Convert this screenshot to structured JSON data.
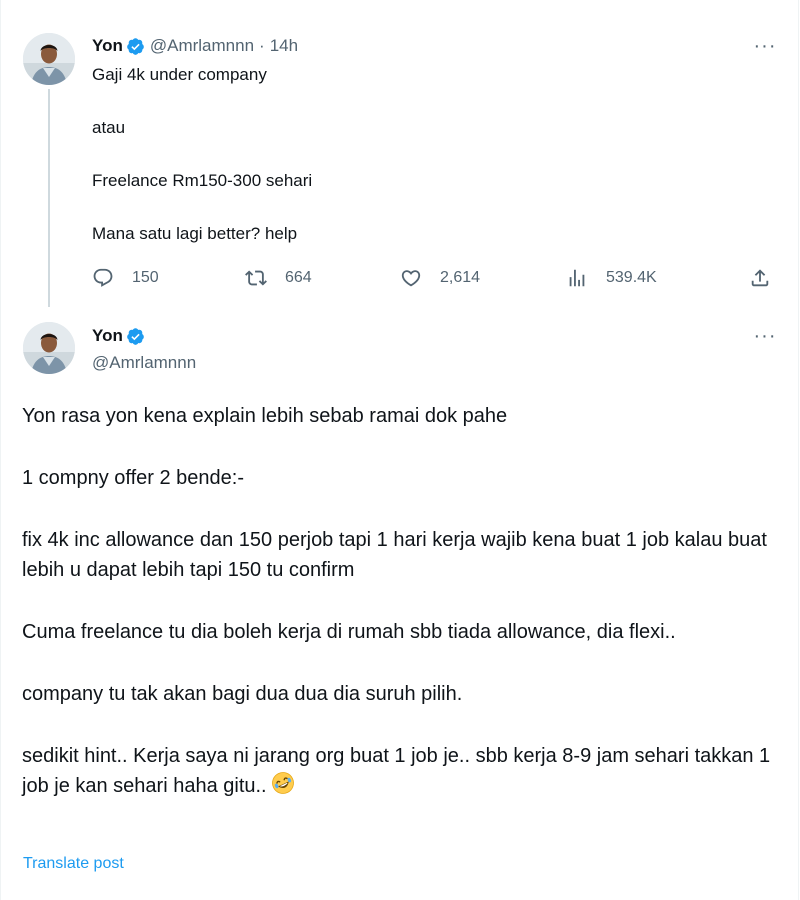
{
  "tweet1": {
    "author_name": "Yon",
    "author_handle": "@Amrlamnnn",
    "separator": "·",
    "time": "14h",
    "more_label": "···",
    "text_lines": [
      "Gaji 4k under company",
      "atau",
      "Freelance Rm150-300 sehari",
      "Mana satu lagi better? help"
    ],
    "stats": {
      "replies": "150",
      "reposts": "664",
      "likes": "2,614",
      "views": "539.4K"
    }
  },
  "tweet2": {
    "author_name": "Yon",
    "author_handle": "@Amrlamnnn",
    "more_label": "···",
    "paragraphs": [
      "Yon rasa yon kena explain lebih sebab ramai dok pahe",
      "1 compny offer 2 bende:-",
      "fix 4k inc allowance dan 150 perjob tapi 1 hari kerja wajib kena buat 1 job kalau buat lebih u dapat lebih tapi 150 tu confirm",
      "Cuma freelance tu dia boleh kerja di rumah sbb tiada allowance, dia flexi..",
      "company tu tak akan bagi dua dua dia suruh pilih.",
      "sedikit hint.. Kerja saya ni jarang org buat 1 job je.. sbb kerja 8-9 jam sehari takkan 1 job je kan sehari haha gitu.."
    ],
    "trailing_emoji": "rolling-on-floor-laughing-emoji",
    "translate_label": "Translate post"
  },
  "colors": {
    "text_primary": "#0f1419",
    "text_secondary": "#536471",
    "accent": "#1d9bf0",
    "verified_badge": "#1d9bf0",
    "thread_line": "#cfd9de"
  }
}
